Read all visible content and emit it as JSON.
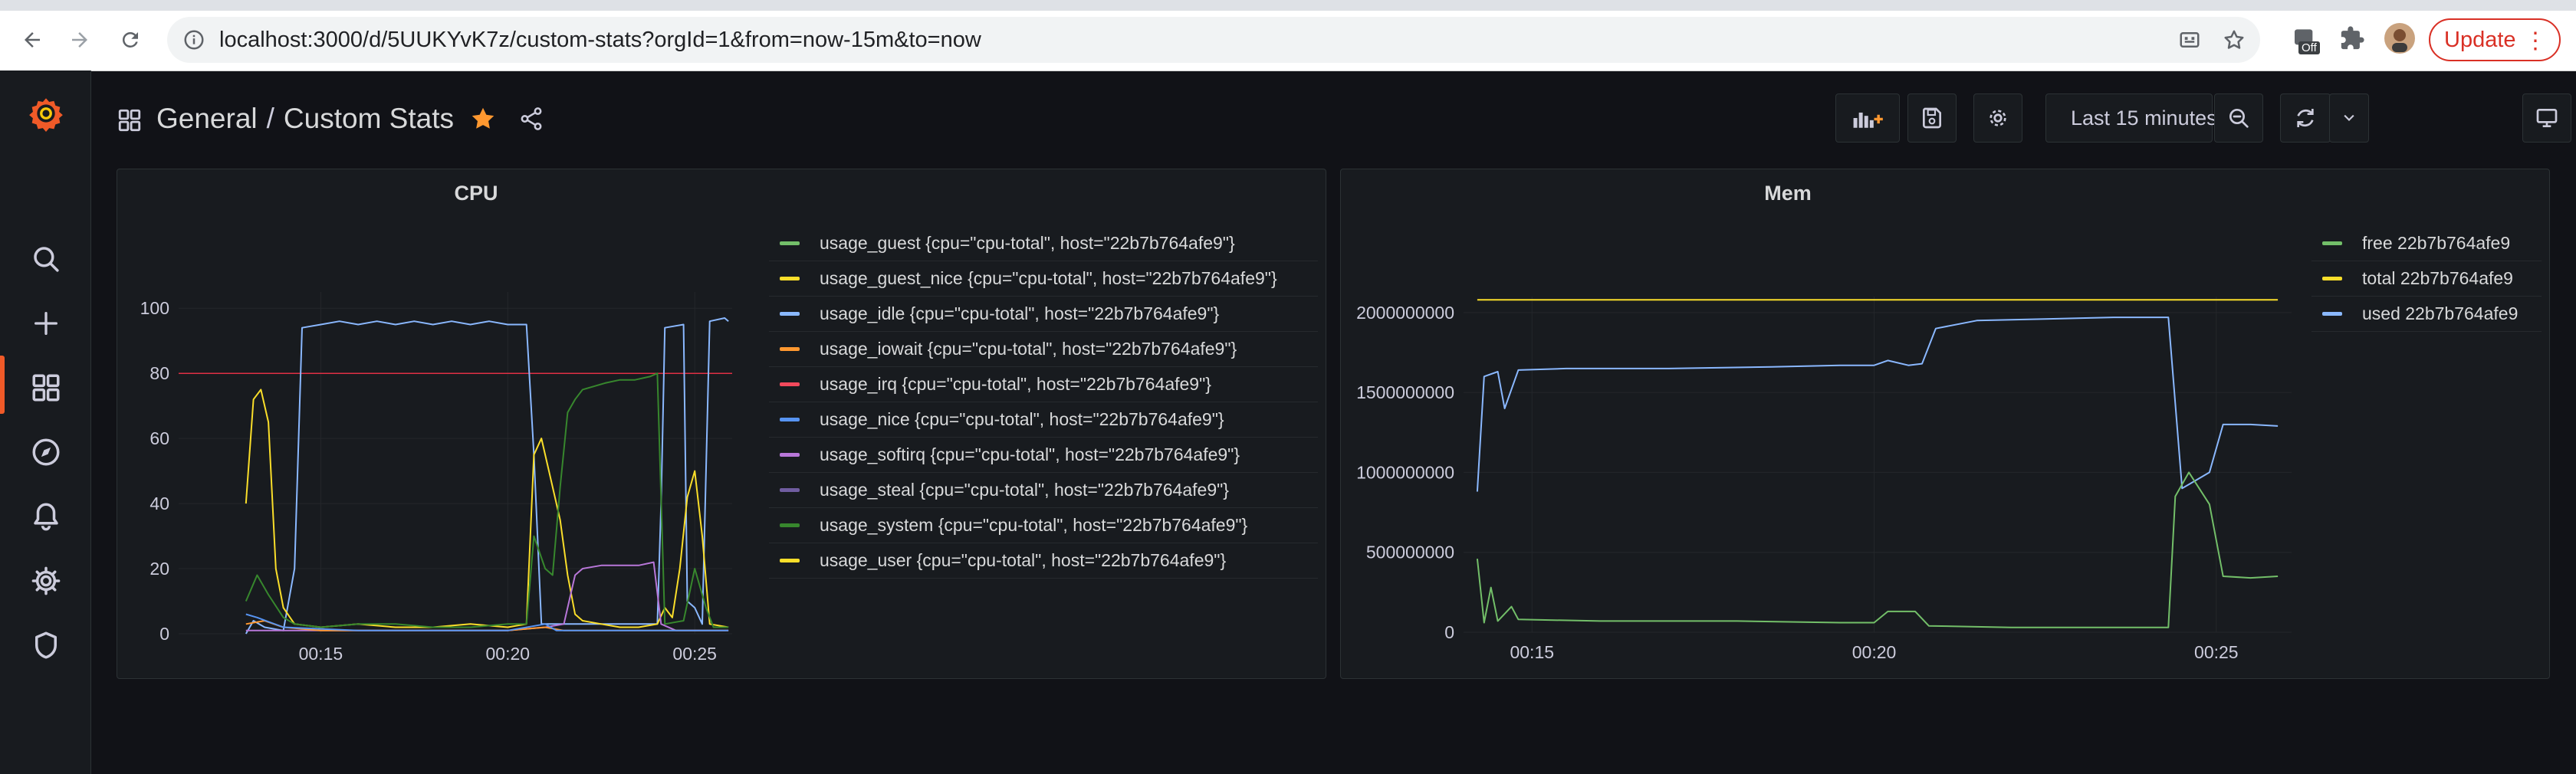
{
  "browser": {
    "url": "localhost:3000/d/5UUKYvK7z/custom-stats?orgId=1&from=now-15m&to=now",
    "update_label": "Update",
    "extension_badge": "Off"
  },
  "dashboard": {
    "folder": "General",
    "separator": "/",
    "title": "Custom Stats",
    "time_range": "Last 15 minutes",
    "starred": true
  },
  "colors": {
    "accent": "#f05a28",
    "star": "#ff9830",
    "panel_bg": "#181b1f",
    "page_bg": "#111217",
    "threshold": "#e02f44"
  },
  "panels": {
    "cpu": {
      "title": "CPU",
      "legend": [
        {
          "label": "usage_guest {cpu=\"cpu-total\", host=\"22b7b764afe9\"}",
          "color": "#73bf69"
        },
        {
          "label": "usage_guest_nice {cpu=\"cpu-total\", host=\"22b7b764afe9\"}",
          "color": "#fade2a"
        },
        {
          "label": "usage_idle {cpu=\"cpu-total\", host=\"22b7b764afe9\"}",
          "color": "#8ab8ff"
        },
        {
          "label": "usage_iowait {cpu=\"cpu-total\", host=\"22b7b764afe9\"}",
          "color": "#ff9830"
        },
        {
          "label": "usage_irq {cpu=\"cpu-total\", host=\"22b7b764afe9\"}",
          "color": "#f2495c"
        },
        {
          "label": "usage_nice {cpu=\"cpu-total\", host=\"22b7b764afe9\"}",
          "color": "#5794f2"
        },
        {
          "label": "usage_softirq {cpu=\"cpu-total\", host=\"22b7b764afe9\"}",
          "color": "#b877d9"
        },
        {
          "label": "usage_steal {cpu=\"cpu-total\", host=\"22b7b764afe9\"}",
          "color": "#705da0"
        },
        {
          "label": "usage_system {cpu=\"cpu-total\", host=\"22b7b764afe9\"}",
          "color": "#37872d"
        },
        {
          "label": "usage_user {cpu=\"cpu-total\", host=\"22b7b764afe9\"}",
          "color": "#fade2a"
        }
      ]
    },
    "mem": {
      "title": "Mem",
      "legend": [
        {
          "label": "free 22b7b764afe9",
          "color": "#73bf69"
        },
        {
          "label": "total 22b7b764afe9",
          "color": "#fade2a"
        },
        {
          "label": "used 22b7b764afe9",
          "color": "#8ab8ff"
        }
      ]
    }
  },
  "chart_data": [
    {
      "type": "line",
      "x_ticks": [
        "00:15",
        "00:20",
        "00:25"
      ],
      "x_tick_minutes": [
        15,
        20,
        25
      ],
      "xlim": [
        11.2,
        26.0
      ],
      "y_ticks": [
        "0",
        "20",
        "40",
        "60",
        "80",
        "100"
      ],
      "ylim": [
        0,
        105
      ],
      "threshold": 80,
      "grid": true,
      "legend_position": "right",
      "series": [
        {
          "name": "usage_idle",
          "color": "#8ab8ff",
          "points": [
            [
              13.0,
              0
            ],
            [
              13.2,
              4
            ],
            [
              13.5,
              2
            ],
            [
              14.0,
              1
            ],
            [
              14.3,
              20
            ],
            [
              14.5,
              94
            ],
            [
              15.0,
              95
            ],
            [
              15.5,
              96
            ],
            [
              16.0,
              95
            ],
            [
              16.5,
              96
            ],
            [
              17.0,
              95
            ],
            [
              17.5,
              96
            ],
            [
              18.0,
              95
            ],
            [
              18.5,
              96
            ],
            [
              19.0,
              95
            ],
            [
              19.5,
              96
            ],
            [
              20.0,
              95
            ],
            [
              20.5,
              95
            ],
            [
              20.7,
              55
            ],
            [
              20.9,
              3
            ],
            [
              21.5,
              3
            ],
            [
              22.0,
              3
            ],
            [
              22.5,
              3
            ],
            [
              23.0,
              3
            ],
            [
              23.5,
              3
            ],
            [
              24.0,
              3
            ],
            [
              24.1,
              40
            ],
            [
              24.2,
              94
            ],
            [
              24.7,
              95
            ],
            [
              24.8,
              10
            ],
            [
              25.0,
              8
            ],
            [
              25.2,
              3
            ],
            [
              25.3,
              50
            ],
            [
              25.4,
              96
            ],
            [
              25.8,
              97
            ],
            [
              25.9,
              96
            ]
          ]
        },
        {
          "name": "usage_user",
          "color": "#fade2a",
          "points": [
            [
              13.0,
              40
            ],
            [
              13.2,
              72
            ],
            [
              13.4,
              75
            ],
            [
              13.6,
              65
            ],
            [
              13.8,
              20
            ],
            [
              14.0,
              8
            ],
            [
              14.3,
              3
            ],
            [
              15.0,
              2
            ],
            [
              16.0,
              3
            ],
            [
              17.0,
              2
            ],
            [
              18.0,
              2
            ],
            [
              19.0,
              3
            ],
            [
              20.0,
              2
            ],
            [
              20.5,
              3
            ],
            [
              20.7,
              55
            ],
            [
              20.9,
              60
            ],
            [
              21.1,
              50
            ],
            [
              21.4,
              35
            ],
            [
              21.6,
              18
            ],
            [
              21.8,
              6
            ],
            [
              22.0,
              4
            ],
            [
              22.5,
              3
            ],
            [
              23.0,
              2
            ],
            [
              23.5,
              2
            ],
            [
              24.0,
              3
            ],
            [
              24.2,
              8
            ],
            [
              24.4,
              5
            ],
            [
              24.6,
              20
            ],
            [
              24.8,
              42
            ],
            [
              25.0,
              50
            ],
            [
              25.2,
              30
            ],
            [
              25.4,
              3
            ],
            [
              25.9,
              2
            ]
          ]
        },
        {
          "name": "usage_system",
          "color": "#37872d",
          "points": [
            [
              13.0,
              10
            ],
            [
              13.3,
              18
            ],
            [
              13.6,
              12
            ],
            [
              14.0,
              5
            ],
            [
              14.3,
              3
            ],
            [
              15.0,
              2
            ],
            [
              16.0,
              3
            ],
            [
              17.0,
              3
            ],
            [
              18.0,
              2
            ],
            [
              19.0,
              2
            ],
            [
              20.0,
              3
            ],
            [
              20.5,
              3
            ],
            [
              20.7,
              30
            ],
            [
              21.0,
              20
            ],
            [
              21.2,
              18
            ],
            [
              21.4,
              45
            ],
            [
              21.6,
              68
            ],
            [
              21.8,
              72
            ],
            [
              22.0,
              75
            ],
            [
              22.3,
              76
            ],
            [
              22.6,
              77
            ],
            [
              23.0,
              78
            ],
            [
              23.4,
              78
            ],
            [
              23.8,
              79
            ],
            [
              24.0,
              80
            ],
            [
              24.2,
              3
            ],
            [
              24.7,
              4
            ],
            [
              25.0,
              20
            ],
            [
              25.3,
              8
            ],
            [
              25.5,
              2
            ],
            [
              25.9,
              2
            ]
          ]
        },
        {
          "name": "usage_softirq",
          "color": "#b877d9",
          "points": [
            [
              13.0,
              1
            ],
            [
              15.0,
              1
            ],
            [
              20.0,
              1
            ],
            [
              21.0,
              2
            ],
            [
              21.5,
              3
            ],
            [
              21.8,
              18
            ],
            [
              22.0,
              20
            ],
            [
              22.5,
              21
            ],
            [
              23.0,
              21
            ],
            [
              23.5,
              21
            ],
            [
              23.9,
              22
            ],
            [
              24.1,
              3
            ],
            [
              24.5,
              1
            ],
            [
              25.9,
              1
            ]
          ]
        },
        {
          "name": "usage_iowait",
          "color": "#ff9830",
          "points": [
            [
              13.0,
              3
            ],
            [
              13.5,
              4
            ],
            [
              14.0,
              2
            ],
            [
              15.0,
              1
            ],
            [
              18.0,
              1
            ],
            [
              20.0,
              1
            ],
            [
              21.0,
              2
            ],
            [
              21.5,
              1
            ],
            [
              25.9,
              1
            ]
          ]
        },
        {
          "name": "usage_nice",
          "color": "#5794f2",
          "points": [
            [
              13.0,
              6
            ],
            [
              13.3,
              5
            ],
            [
              14.0,
              2
            ],
            [
              16.0,
              1
            ],
            [
              20.0,
              1
            ],
            [
              21.0,
              3
            ],
            [
              21.3,
              1
            ],
            [
              25.9,
              1
            ]
          ]
        }
      ]
    },
    {
      "type": "line",
      "x_ticks": [
        "00:15",
        "00:20",
        "00:25"
      ],
      "x_tick_minutes": [
        15,
        20,
        25
      ],
      "xlim": [
        14.0,
        26.1
      ],
      "y_ticks": [
        "0",
        "500000000",
        "1000000000",
        "1500000000",
        "2000000000"
      ],
      "ylim": [
        0,
        2100000000
      ],
      "grid": true,
      "legend_position": "right",
      "series": [
        {
          "name": "total",
          "color": "#fade2a",
          "points": [
            [
              14.2,
              2080000000
            ],
            [
              25.9,
              2080000000
            ]
          ]
        },
        {
          "name": "used",
          "color": "#8ab8ff",
          "points": [
            [
              14.2,
              880000000
            ],
            [
              14.3,
              1600000000
            ],
            [
              14.5,
              1630000000
            ],
            [
              14.6,
              1400000000
            ],
            [
              14.8,
              1640000000
            ],
            [
              15.5,
              1650000000
            ],
            [
              17.0,
              1650000000
            ],
            [
              18.5,
              1660000000
            ],
            [
              19.5,
              1670000000
            ],
            [
              20.0,
              1670000000
            ],
            [
              20.2,
              1700000000
            ],
            [
              20.5,
              1670000000
            ],
            [
              20.7,
              1680000000
            ],
            [
              20.9,
              1900000000
            ],
            [
              21.5,
              1950000000
            ],
            [
              22.5,
              1960000000
            ],
            [
              23.5,
              1970000000
            ],
            [
              24.3,
              1970000000
            ],
            [
              24.5,
              900000000
            ],
            [
              24.7,
              950000000
            ],
            [
              24.9,
              1000000000
            ],
            [
              25.1,
              1300000000
            ],
            [
              25.5,
              1300000000
            ],
            [
              25.9,
              1290000000
            ]
          ]
        },
        {
          "name": "free",
          "color": "#73bf69",
          "points": [
            [
              14.2,
              460000000
            ],
            [
              14.3,
              60000000
            ],
            [
              14.4,
              280000000
            ],
            [
              14.5,
              70000000
            ],
            [
              14.7,
              160000000
            ],
            [
              14.8,
              80000000
            ],
            [
              16.0,
              70000000
            ],
            [
              18.0,
              70000000
            ],
            [
              19.5,
              60000000
            ],
            [
              20.0,
              60000000
            ],
            [
              20.2,
              130000000
            ],
            [
              20.6,
              130000000
            ],
            [
              20.8,
              40000000
            ],
            [
              22.0,
              30000000
            ],
            [
              23.0,
              30000000
            ],
            [
              24.3,
              30000000
            ],
            [
              24.4,
              850000000
            ],
            [
              24.6,
              1000000000
            ],
            [
              24.9,
              800000000
            ],
            [
              25.1,
              350000000
            ],
            [
              25.5,
              340000000
            ],
            [
              25.9,
              350000000
            ]
          ]
        }
      ]
    }
  ]
}
